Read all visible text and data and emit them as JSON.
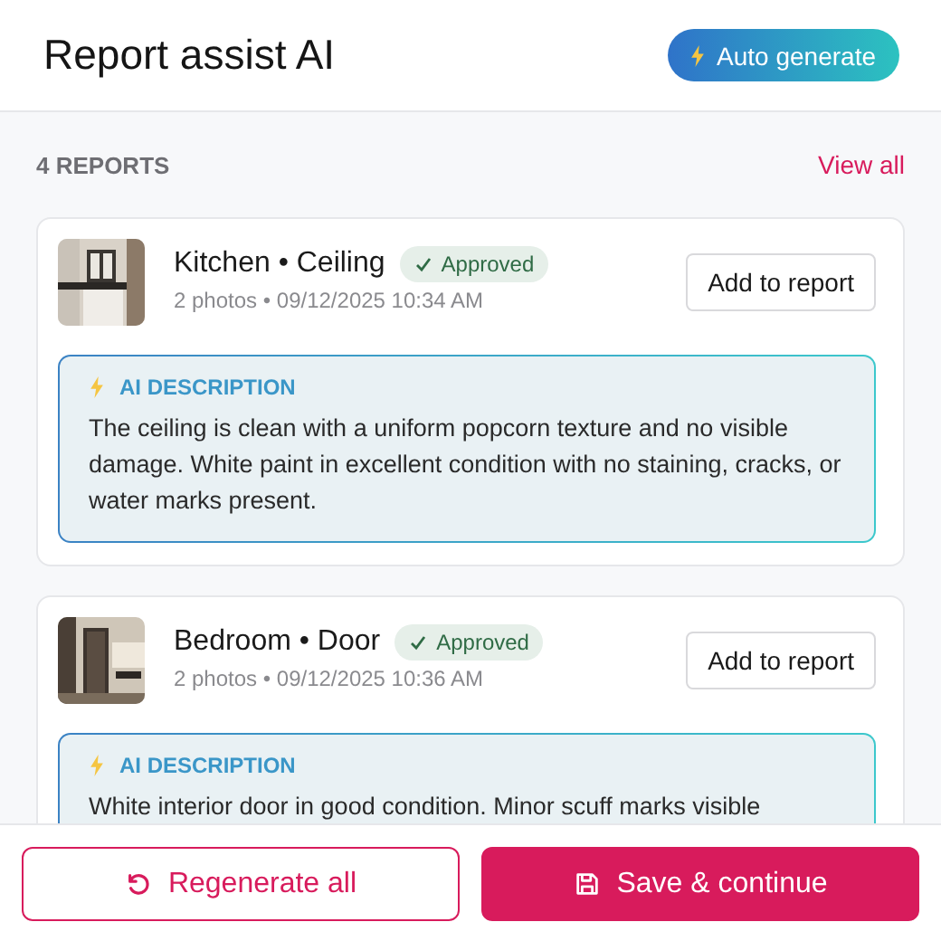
{
  "header": {
    "title": "Report assist AI",
    "action": "Auto generate"
  },
  "summary": {
    "count": "4 REPORTS",
    "link": "View all"
  },
  "reports": [
    {
      "kind": "kitchen",
      "title": "Kitchen • Ceiling",
      "status": {
        "kind": "approved",
        "label": "Approved"
      },
      "meta": "2 photos • 09/12/2025 10:34 AM",
      "button": "Add to report",
      "ai": {
        "heading": "AI DESCRIPTION",
        "text": "The ceiling is clean with a uniform popcorn texture and no visible damage. White paint in excellent condition with no staining, cracks, or water marks present."
      }
    },
    {
      "kind": "door",
      "title": "Bedroom • Door",
      "status": {
        "kind": "approved",
        "label": "Approved"
      },
      "meta": "2 photos • 09/12/2025 10:36 AM",
      "button": "Add to report",
      "ai": {
        "heading": "AI DESCRIPTION",
        "text": "White interior door in good condition. Minor scuff marks visible"
      }
    }
  ],
  "footer": {
    "secondary": "Regenerate all",
    "primary": "Save & continue"
  }
}
